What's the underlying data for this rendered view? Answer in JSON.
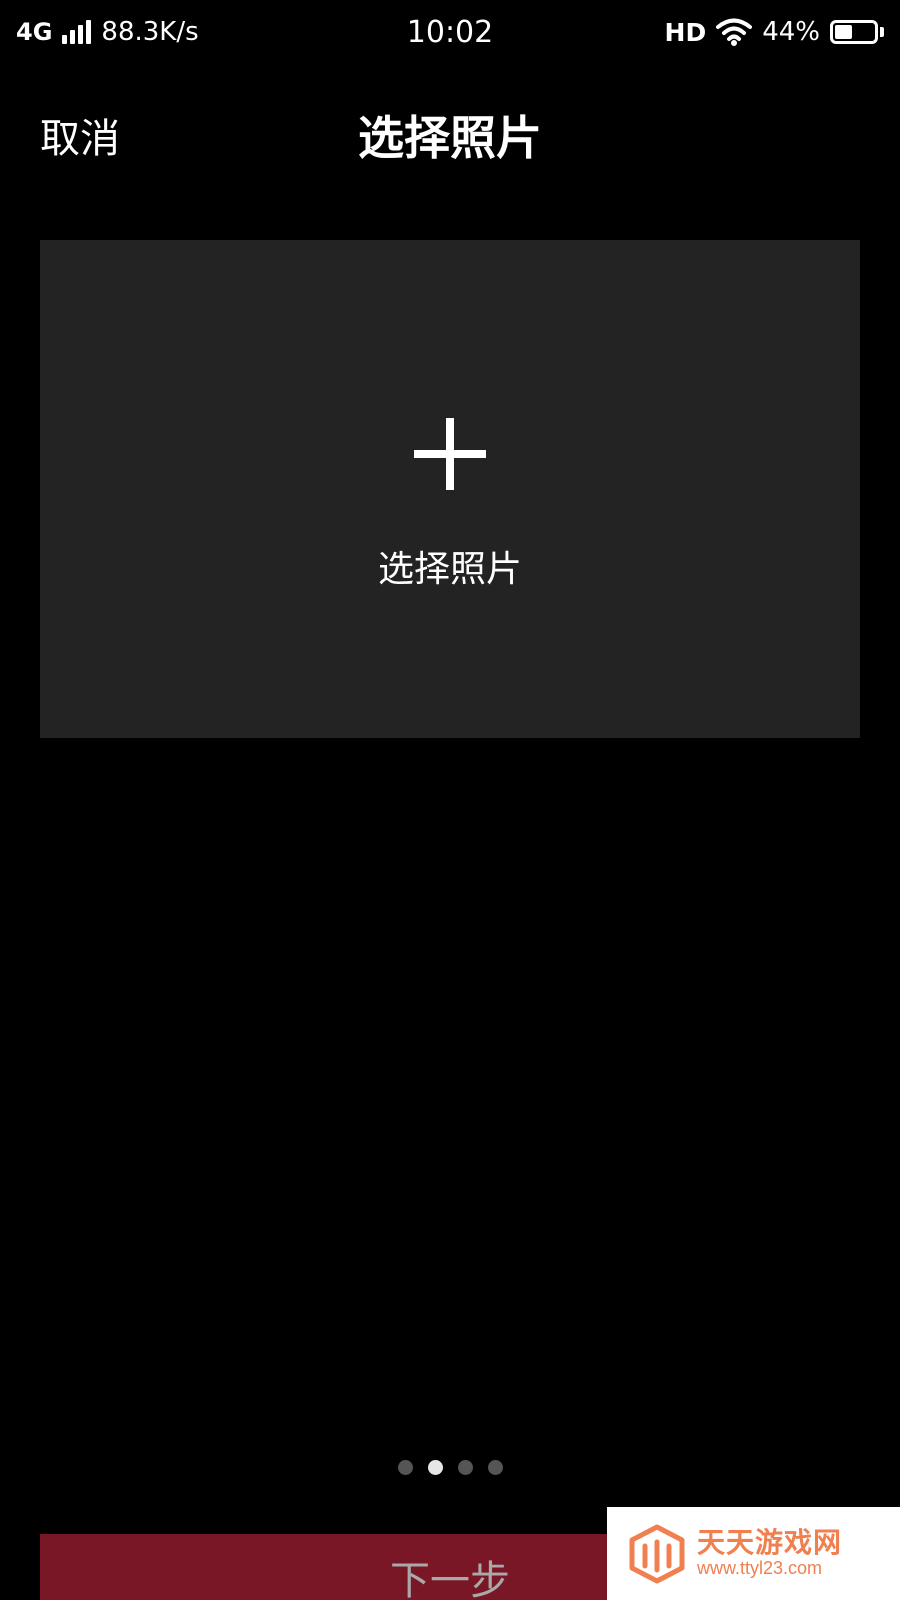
{
  "status_bar": {
    "network_type": "4G",
    "speed": "88.3K/s",
    "time": "10:02",
    "hd_label": "HD",
    "battery_percent": "44%",
    "battery_level": 0.44
  },
  "nav": {
    "cancel_label": "取消",
    "title": "选择照片"
  },
  "picker": {
    "label": "选择照片",
    "icon": "plus-icon"
  },
  "pager": {
    "count": 4,
    "active_index": 1
  },
  "footer": {
    "next_label": "下一步"
  },
  "watermark": {
    "name": "天天游戏网",
    "url": "www.ttyl23.com"
  },
  "colors": {
    "background": "#000000",
    "picker_bg": "#232323",
    "next_button_bg": "#7a1727",
    "dot_inactive": "#555555",
    "dot_active": "#e6e6e6",
    "watermark_accent": "#f08050"
  }
}
